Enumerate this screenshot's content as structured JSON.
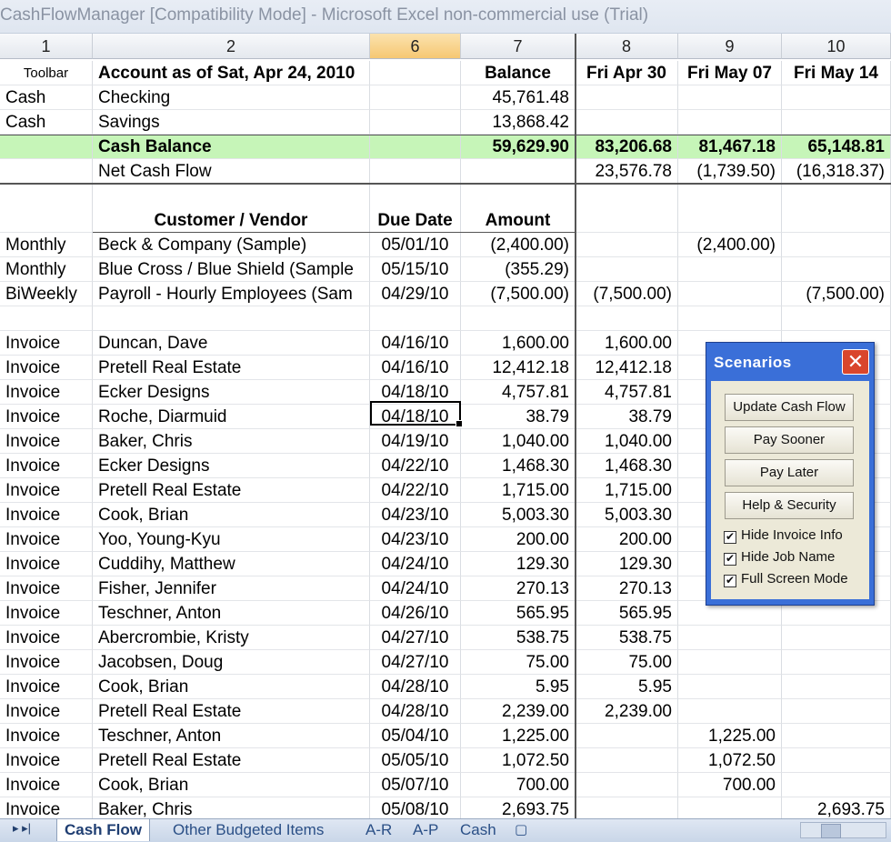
{
  "window": {
    "title": "CashFlowManager  [Compatibility Mode] - Microsoft Excel non-commercial use (Trial)"
  },
  "columns": [
    {
      "label": "1"
    },
    {
      "label": "2"
    },
    {
      "label": "6"
    },
    {
      "label": "7"
    },
    {
      "label": "8"
    },
    {
      "label": "9"
    },
    {
      "label": "10"
    }
  ],
  "summary": {
    "toolbar_label": "Toolbar",
    "account_heading": "Account as of Sat, Apr 24, 2010",
    "balance_heading": "Balance",
    "dates": [
      "Fri Apr 30",
      "Fri May 07",
      "Fri May 14"
    ],
    "accounts": [
      {
        "type": "Cash",
        "name": "Checking",
        "balance": "45,761.48"
      },
      {
        "type": "Cash",
        "name": "Savings",
        "balance": "13,868.42"
      }
    ],
    "cash_balance": {
      "label": "Cash Balance",
      "balance": "59,629.90",
      "weeks": [
        "83,206.68",
        "81,467.18",
        "65,148.81"
      ]
    },
    "net_cash_flow": {
      "label": "Net Cash Flow",
      "weeks": [
        "23,576.78",
        "(1,739.50)",
        "(16,318.37)"
      ]
    }
  },
  "detail_headers": {
    "vendor": "Customer / Vendor",
    "due": "Due Date",
    "amount": "Amount"
  },
  "recurring": [
    {
      "type": "Monthly",
      "name": "Beck & Company (Sample)",
      "due": "05/01/10",
      "amount": "(2,400.00)",
      "w1": "",
      "w2": "(2,400.00)",
      "w3": ""
    },
    {
      "type": "Monthly",
      "name": "Blue Cross / Blue Shield  (Sample",
      "due": "05/15/10",
      "amount": "(355.29)",
      "w1": "",
      "w2": "",
      "w3": ""
    },
    {
      "type": "BiWeekly",
      "name": "Payroll - Hourly Employees  (Sam",
      "due": "04/29/10",
      "amount": "(7,500.00)",
      "w1": "(7,500.00)",
      "w2": "",
      "w3": "(7,500.00)"
    }
  ],
  "invoices": [
    {
      "type": "Invoice",
      "name": "Duncan, Dave",
      "due": "04/16/10",
      "amount": "1,600.00",
      "w1": "1,600.00",
      "w2": "",
      "w3": ""
    },
    {
      "type": "Invoice",
      "name": "Pretell Real Estate",
      "due": "04/16/10",
      "amount": "12,412.18",
      "w1": "12,412.18",
      "w2": "",
      "w3": ""
    },
    {
      "type": "Invoice",
      "name": "Ecker Designs",
      "due": "04/18/10",
      "amount": "4,757.81",
      "w1": "4,757.81",
      "w2": "",
      "w3": ""
    },
    {
      "type": "Invoice",
      "name": "Roche, Diarmuid",
      "due": "04/18/10",
      "amount": "38.79",
      "w1": "38.79",
      "w2": "",
      "w3": ""
    },
    {
      "type": "Invoice",
      "name": "Baker, Chris",
      "due": "04/19/10",
      "amount": "1,040.00",
      "w1": "1,040.00",
      "w2": "",
      "w3": ""
    },
    {
      "type": "Invoice",
      "name": "Ecker Designs",
      "due": "04/22/10",
      "amount": "1,468.30",
      "w1": "1,468.30",
      "w2": "",
      "w3": ""
    },
    {
      "type": "Invoice",
      "name": "Pretell Real Estate",
      "due": "04/22/10",
      "amount": "1,715.00",
      "w1": "1,715.00",
      "w2": "",
      "w3": ""
    },
    {
      "type": "Invoice",
      "name": "Cook, Brian",
      "due": "04/23/10",
      "amount": "5,003.30",
      "w1": "5,003.30",
      "w2": "",
      "w3": ""
    },
    {
      "type": "Invoice",
      "name": "Yoo, Young-Kyu",
      "due": "04/23/10",
      "amount": "200.00",
      "w1": "200.00",
      "w2": "",
      "w3": ""
    },
    {
      "type": "Invoice",
      "name": "Cuddihy, Matthew",
      "due": "04/24/10",
      "amount": "129.30",
      "w1": "129.30",
      "w2": "",
      "w3": ""
    },
    {
      "type": "Invoice",
      "name": "Fisher, Jennifer",
      "due": "04/24/10",
      "amount": "270.13",
      "w1": "270.13",
      "w2": "",
      "w3": ""
    },
    {
      "type": "Invoice",
      "name": "Teschner, Anton",
      "due": "04/26/10",
      "amount": "565.95",
      "w1": "565.95",
      "w2": "",
      "w3": ""
    },
    {
      "type": "Invoice",
      "name": "Abercrombie, Kristy",
      "due": "04/27/10",
      "amount": "538.75",
      "w1": "538.75",
      "w2": "",
      "w3": ""
    },
    {
      "type": "Invoice",
      "name": "Jacobsen, Doug",
      "due": "04/27/10",
      "amount": "75.00",
      "w1": "75.00",
      "w2": "",
      "w3": ""
    },
    {
      "type": "Invoice",
      "name": "Cook, Brian",
      "due": "04/28/10",
      "amount": "5.95",
      "w1": "5.95",
      "w2": "",
      "w3": ""
    },
    {
      "type": "Invoice",
      "name": "Pretell Real Estate",
      "due": "04/28/10",
      "amount": "2,239.00",
      "w1": "2,239.00",
      "w2": "",
      "w3": ""
    },
    {
      "type": "Invoice",
      "name": "Teschner, Anton",
      "due": "05/04/10",
      "amount": "1,225.00",
      "w1": "",
      "w2": "1,225.00",
      "w3": ""
    },
    {
      "type": "Invoice",
      "name": "Pretell Real Estate",
      "due": "05/05/10",
      "amount": "1,072.50",
      "w1": "",
      "w2": "1,072.50",
      "w3": ""
    },
    {
      "type": "Invoice",
      "name": "Cook, Brian",
      "due": "05/07/10",
      "amount": "700.00",
      "w1": "",
      "w2": "700.00",
      "w3": ""
    },
    {
      "type": "Invoice",
      "name": "Baker, Chris",
      "due": "05/08/10",
      "amount": "2,693.75",
      "w1": "",
      "w2": "",
      "w3": "2,693.75"
    }
  ],
  "scenarios": {
    "title": "Scenarios",
    "close_glyph": "✕",
    "buttons": [
      {
        "label": "Update Cash Flow"
      },
      {
        "label": "Pay Sooner"
      },
      {
        "label": "Pay Later"
      },
      {
        "label": "Help & Security"
      }
    ],
    "options": [
      {
        "label": "Hide Invoice Info",
        "checked": true
      },
      {
        "label": "Hide Job Name",
        "checked": true
      },
      {
        "label": "Full Screen Mode",
        "checked": true
      }
    ],
    "check_glyph": "✔"
  },
  "sheet_tabs": {
    "nav_glyphs": "▸ ▸|",
    "tabs": [
      {
        "label": "Cash Flow",
        "active": true
      },
      {
        "label": "Other Budgeted Items",
        "active": false
      },
      {
        "label": "A-R",
        "active": false
      },
      {
        "label": "A-P",
        "active": false
      },
      {
        "label": "Cash",
        "active": false
      }
    ]
  }
}
